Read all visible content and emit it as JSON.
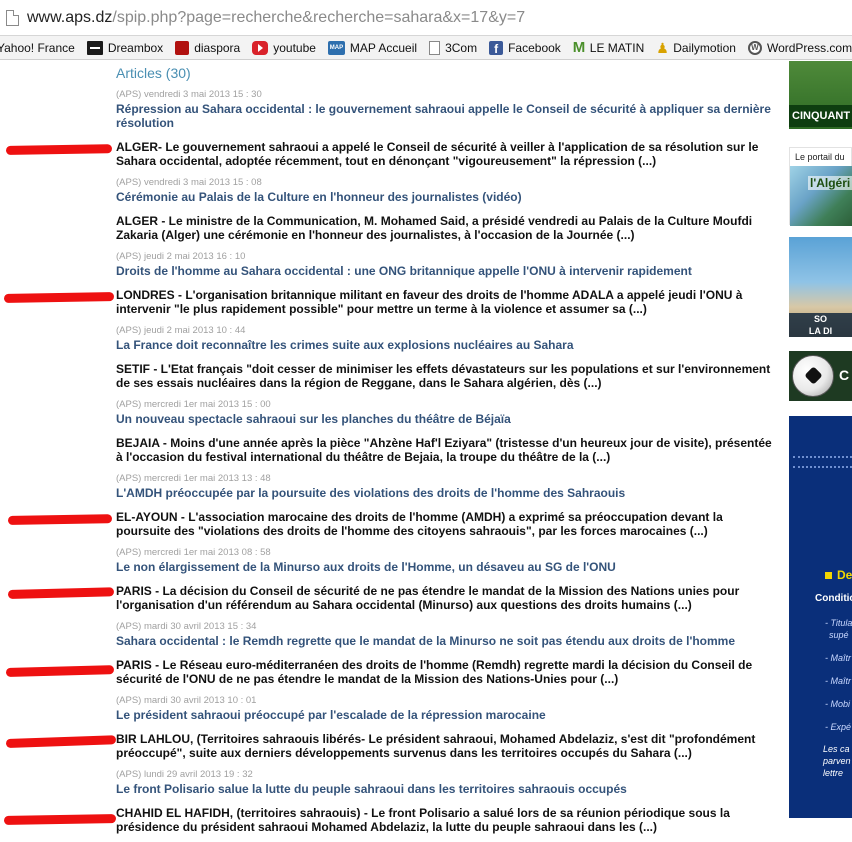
{
  "address_bar": {
    "domain": "www.aps.dz",
    "path": "/spip.php?page=recherche&recherche=sahara&x=17&y=7"
  },
  "bookmarks": [
    {
      "label": "Yahoo! France",
      "icon": "none"
    },
    {
      "label": "Dreambox",
      "icon": "dreambox-icon"
    },
    {
      "label": "diaspora",
      "icon": "diaspora-icon"
    },
    {
      "label": "youtube",
      "icon": "youtube-icon"
    },
    {
      "label": "MAP Accueil",
      "icon": "map-icon",
      "icon_text": "MAP"
    },
    {
      "label": "3Com",
      "icon": "page-icon"
    },
    {
      "label": "Facebook",
      "icon": "facebook-icon",
      "icon_text": "f"
    },
    {
      "label": "LE MATIN",
      "icon": "lematin-icon",
      "icon_text": "M"
    },
    {
      "label": "Dailymotion",
      "icon": "dailymotion-icon"
    },
    {
      "label": "WordPress.com",
      "icon": "wordpress-icon",
      "icon_text": "W"
    }
  ],
  "section": {
    "title": "Articles (30)"
  },
  "articles": [
    {
      "meta": "(APS) vendredi 3 mai 2013 15 : 30",
      "title": "Répression au Sahara occidental : le gouvernement sahraoui appelle le Conseil de sécurité à appliquer sa dernière résolution",
      "summary": "ALGER- Le gouvernement sahraoui a appelé le Conseil de sécurité à veiller à l'application de sa résolution sur le Sahara occidental, adoptée récemment, tout en dénonçant \"vigoureusement\" la répression (...)"
    },
    {
      "meta": "(APS) vendredi 3 mai 2013 15 : 08",
      "title": "Cérémonie au Palais de la Culture en l'honneur des journalistes (vidéo)",
      "summary": "ALGER - Le ministre de la Communication, M. Mohamed Said, a présidé vendredi au Palais de la Culture Moufdi Zakaria (Alger) une cérémonie en l'honneur des journalistes, à l'occasion de la Journée (...)"
    },
    {
      "meta": "(APS) jeudi 2 mai 2013 16 : 10",
      "title": "Droits de l'homme au Sahara occidental : une ONG britannique appelle l'ONU à intervenir rapidement",
      "summary": "LONDRES - L'organisation britannique militant en faveur des droits de l'homme ADALA a appelé jeudi l'ONU à intervenir \"le plus rapidement possible\" pour mettre un terme à la violence et assumer sa (...)"
    },
    {
      "meta": "(APS) jeudi 2 mai 2013 10 : 44",
      "title": "La France doit reconnaître les crimes suite aux explosions nucléaires au Sahara",
      "summary": "SETIF - L'Etat français \"doit cesser de minimiser les effets dévastateurs sur les populations et sur l'environnement de ses essais nucléaires dans la région de Reggane, dans le Sahara algérien, dès (...)"
    },
    {
      "meta": "(APS) mercredi 1er mai 2013 15 : 00",
      "title": "Un nouveau spectacle sahraoui sur les planches du théâtre de Béjaïa",
      "summary": "BEJAIA - Moins d'une année après la pièce \"Ahzène Haf'l Eziyara\" (tristesse d'un heureux jour de visite), présentée à l'occasion du festival international du théâtre de Bejaia, la troupe du théâtre de la (...)"
    },
    {
      "meta": "(APS) mercredi 1er mai 2013 13 : 48",
      "title": "L'AMDH préoccupée par la poursuite des violations des droits de l'homme des Sahraouis",
      "summary": "EL-AYOUN - L'association marocaine des droits de l'homme (AMDH) a exprimé sa préoccupation devant la poursuite des \"violations des droits de l'homme des citoyens sahraouis\", par les forces marocaines (...)"
    },
    {
      "meta": "(APS) mercredi 1er mai 2013 08 : 58",
      "title": "Le non élargissement de la Minurso aux droits de l'Homme, un désaveu au SG de l'ONU",
      "summary": "PARIS - La décision du Conseil de sécurité de ne pas étendre le mandat de la Mission des Nations unies pour l'organisation d'un référendum au Sahara occidental (Minurso) aux questions des droits humains (...)"
    },
    {
      "meta": "(APS) mardi 30 avril 2013 15 : 34",
      "title": "Sahara occidental : le Remdh regrette que le mandat de la Minurso ne soit pas étendu aux droits de l'homme",
      "summary": "PARIS - Le Réseau euro-méditerranéen des droits de l'homme (Remdh) regrette mardi la décision du Conseil de sécurité de l'ONU de ne pas étendre le mandat de la Mission des Nations-Unies pour (...)"
    },
    {
      "meta": "(APS) mardi 30 avril 2013 10 : 01",
      "title": "Le président sahraoui préoccupé par l'escalade de la répression marocaine",
      "summary": "BIR LAHLOU, (Territoires sahraouis libérés- Le président sahraoui, Mohamed Abdelaziz, s'est dit \"profondément préoccupé\", suite aux derniers développements survenus dans les territoires occupés du Sahara (...)"
    },
    {
      "meta": "(APS) lundi 29 avril 2013 19 : 32",
      "title": "Le front Polisario salue la lutte du peuple sahraoui dans les territoires sahraouis occupés",
      "summary": "CHAHID EL HAFIDH, (territoires sahraouis) - Le front Polisario a salué lors de sa réunion périodique sous la présidence du président sahraoui Mohamed Abdelaziz, la lutte du peuple sahraoui dans les (...)"
    }
  ],
  "sidebar": {
    "ad1_text": "CINQUANT",
    "ad2_header": "Le portail du",
    "ad2_logo": "l'Algéri",
    "ad3_line1": "SO",
    "ad3_line2": "LA DI",
    "ad4_letter": "C",
    "ad5_heading": "De",
    "ad5_conditions": "Conditio",
    "ad5_items": [
      "- Titula",
      "supé",
      "- Maîtr",
      "- Maîtr",
      "- Mobi",
      "- Expé"
    ],
    "ad5_footer": [
      "Les ca",
      "parven",
      "lettre"
    ]
  },
  "colors": {
    "title_link": "#34537a",
    "section_title": "#4a8fb2",
    "meta": "#a0a0a0",
    "marker": "#ee1111",
    "sidebar_blue": "#0a2f7a"
  }
}
